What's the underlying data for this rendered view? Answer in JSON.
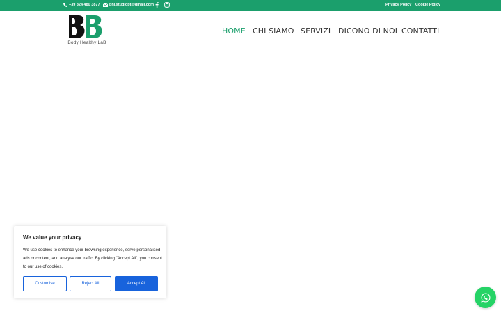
{
  "topbar": {
    "phone": "+39 324 480 3877",
    "email": "bhl.studiopt@gmail.com",
    "privacy_label": "Privacy Policy",
    "cookie_label": "Cookie Policy"
  },
  "brand": {
    "tagline": "Body Healthy LaB"
  },
  "nav": {
    "home": "HOME",
    "chi_siamo": "CHI SIAMO",
    "servizi": "SERVIZI",
    "dicono": "DICONO DI NOI",
    "contatti": "CONTATTI"
  },
  "cookie": {
    "title": "We value your privacy",
    "body": "We use cookies to enhance your browsing experience, serve personalised ads or content, and analyse our traffic. By clicking \"Accept All\", you consent to our use of cookies.",
    "customise": "Customise",
    "reject": "Reject All",
    "accept": "Accept All"
  },
  "colors": {
    "brand_green": "#1b9f6c",
    "cookie_blue": "#1863dc",
    "whatsapp_green": "#25d366"
  }
}
